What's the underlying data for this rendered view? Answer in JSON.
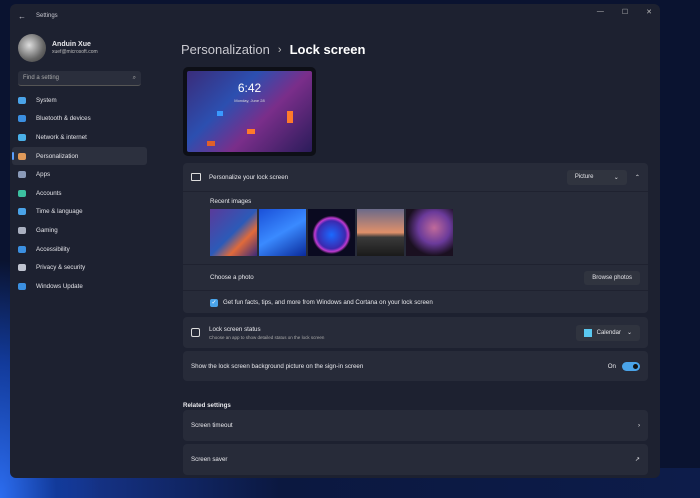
{
  "window": {
    "title": "Settings",
    "back": "←",
    "minimize": "—",
    "maximize": "☐",
    "close": "✕"
  },
  "profile": {
    "name": "Anduin Xue",
    "email": "xuef@microsoft.com"
  },
  "search": {
    "placeholder": "Find a setting",
    "icon": "⌕"
  },
  "nav": [
    {
      "label": "System",
      "color": "#4aa3e8"
    },
    {
      "label": "Bluetooth & devices",
      "color": "#3b8fe0"
    },
    {
      "label": "Network & internet",
      "color": "#4ab0e8"
    },
    {
      "label": "Personalization",
      "color": "#e09a5a",
      "active": true
    },
    {
      "label": "Apps",
      "color": "#8a9ab8"
    },
    {
      "label": "Accounts",
      "color": "#3cc0a0"
    },
    {
      "label": "Time & language",
      "color": "#4aa3e8"
    },
    {
      "label": "Gaming",
      "color": "#aab0c0"
    },
    {
      "label": "Accessibility",
      "color": "#3b8fe0"
    },
    {
      "label": "Privacy & security",
      "color": "#c0c4d0"
    },
    {
      "label": "Windows Update",
      "color": "#3b8fe0"
    }
  ],
  "breadcrumb": {
    "parent": "Personalization",
    "separator": "›",
    "current": "Lock screen"
  },
  "preview": {
    "time": "6:42",
    "date": "Monday, June 28"
  },
  "personalize": {
    "label": "Personalize your lock screen",
    "value": "Picture",
    "recent_label": "Recent images",
    "choose_label": "Choose a photo",
    "browse": "Browse photos",
    "checkbox_label": "Get fun facts, tips, and more from Windows and Cortana on your lock screen",
    "checked": true
  },
  "status": {
    "label": "Lock screen status",
    "desc": "Choose an app to show detailed status on the lock screen",
    "value": "Calendar"
  },
  "signin": {
    "label": "Show the lock screen background picture on the sign-in screen",
    "state": "On"
  },
  "related": {
    "title": "Related settings",
    "items": [
      {
        "label": "Screen timeout",
        "icon": "›"
      },
      {
        "label": "Screen saver",
        "icon": "↗"
      }
    ]
  }
}
